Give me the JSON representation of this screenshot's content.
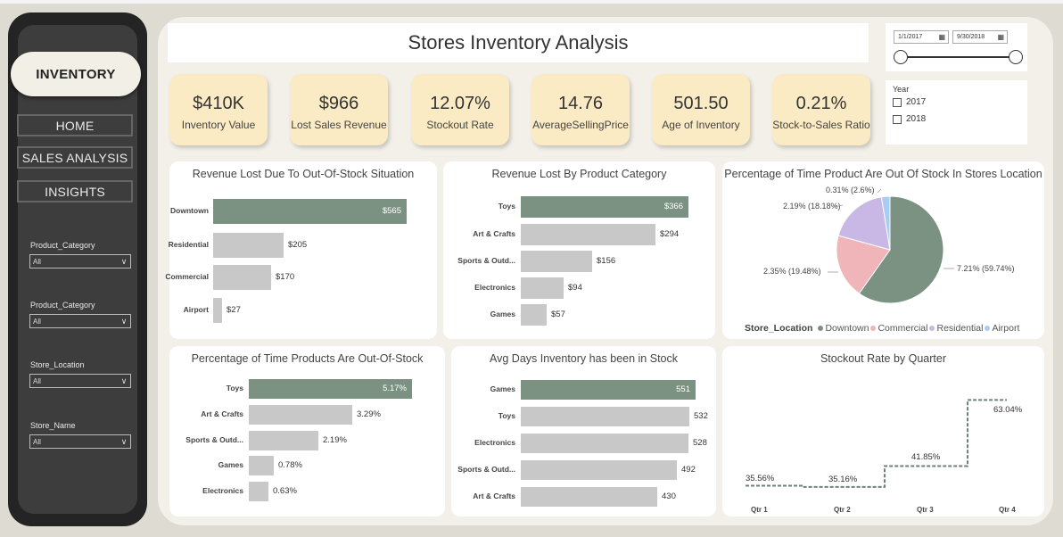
{
  "sidebar": {
    "active_page": "INVENTORY",
    "nav": [
      "HOME",
      "SALES ANALYSIS",
      "INSIGHTS"
    ],
    "slicers": [
      {
        "label": "Product_Category",
        "value": "All"
      },
      {
        "label": "Product_Category",
        "value": "All"
      },
      {
        "label": "Store_Location",
        "value": "All"
      },
      {
        "label": "Store_Name",
        "value": "All"
      }
    ]
  },
  "header": {
    "title": "Stores Inventory Analysis"
  },
  "date_range": {
    "start": "1/1/2017",
    "end": "9/30/2018"
  },
  "year_filter": {
    "title": "Year",
    "options": [
      "2017",
      "2018"
    ]
  },
  "kpis": [
    {
      "value": "$410K",
      "label": "Inventory Value"
    },
    {
      "value": "$966",
      "label": "Lost Sales Revenue"
    },
    {
      "value": "12.07%",
      "label": "Stockout Rate"
    },
    {
      "value": "14.76",
      "label": "AverageSellingPrice"
    },
    {
      "value": "501.50",
      "label": "Age of Inventory"
    },
    {
      "value": "0.21%",
      "label": "Stock-to-Sales Ratio"
    }
  ],
  "colors": {
    "highlight": "#7b9282",
    "bar": "#c8c8c8",
    "downtown": "#7b9282",
    "commercial": "#efb5b8",
    "residential": "#c9b8e6",
    "airport": "#a9cdf2"
  },
  "chart_data": [
    {
      "type": "bar",
      "title": "Revenue Lost Due To Out-Of-Stock Situation",
      "categories": [
        "Downtown",
        "Residential",
        "Commercial",
        "Airport"
      ],
      "values": [
        565,
        205,
        170,
        27
      ],
      "labels": [
        "$565",
        "$205",
        "$170",
        "$27"
      ]
    },
    {
      "type": "bar",
      "title": "Revenue Lost By Product Category",
      "categories": [
        "Toys",
        "Art & Crafts",
        "Sports & Outd...",
        "Electronics",
        "Games"
      ],
      "values": [
        366,
        294,
        156,
        94,
        57
      ],
      "labels": [
        "$366",
        "$294",
        "$156",
        "$94",
        "$57"
      ]
    },
    {
      "type": "pie",
      "title": "Percentage of Time Product Are Out Of Stock In Stores Location",
      "legend_title": "Store_Location",
      "series": [
        {
          "name": "Downtown",
          "value": 7.21,
          "label": "7.21% (59.74%)"
        },
        {
          "name": "Commercial",
          "value": 2.35,
          "label": "2.35% (19.48%)"
        },
        {
          "name": "Residential",
          "value": 2.19,
          "label": "2.19% (18.18%)"
        },
        {
          "name": "Airport",
          "value": 0.31,
          "label": "0.31% (2.6%)"
        }
      ]
    },
    {
      "type": "bar",
      "title": "Percentage of Time Products Are Out-Of-Stock",
      "categories": [
        "Toys",
        "Art & Crafts",
        "Sports & Outd...",
        "Games",
        "Electronics"
      ],
      "values": [
        5.17,
        3.29,
        2.19,
        0.78,
        0.63
      ],
      "labels": [
        "5.17%",
        "3.29%",
        "2.19%",
        "0.78%",
        "0.63%"
      ]
    },
    {
      "type": "bar",
      "title": "Avg Days Inventory has been in Stock",
      "categories": [
        "Games",
        "Toys",
        "Electronics",
        "Sports & Outd...",
        "Art & Crafts"
      ],
      "values": [
        551,
        532,
        528,
        492,
        430
      ],
      "labels": [
        "551",
        "532",
        "528",
        "492",
        "430"
      ]
    },
    {
      "type": "line",
      "title": "Stockout Rate by Quarter",
      "categories": [
        "Qtr 1",
        "Qtr 2",
        "Qtr 3",
        "Qtr 4"
      ],
      "values": [
        35.56,
        35.16,
        41.85,
        63.04
      ],
      "labels": [
        "35.56%",
        "35.16%",
        "41.85%",
        "63.04%"
      ]
    }
  ]
}
